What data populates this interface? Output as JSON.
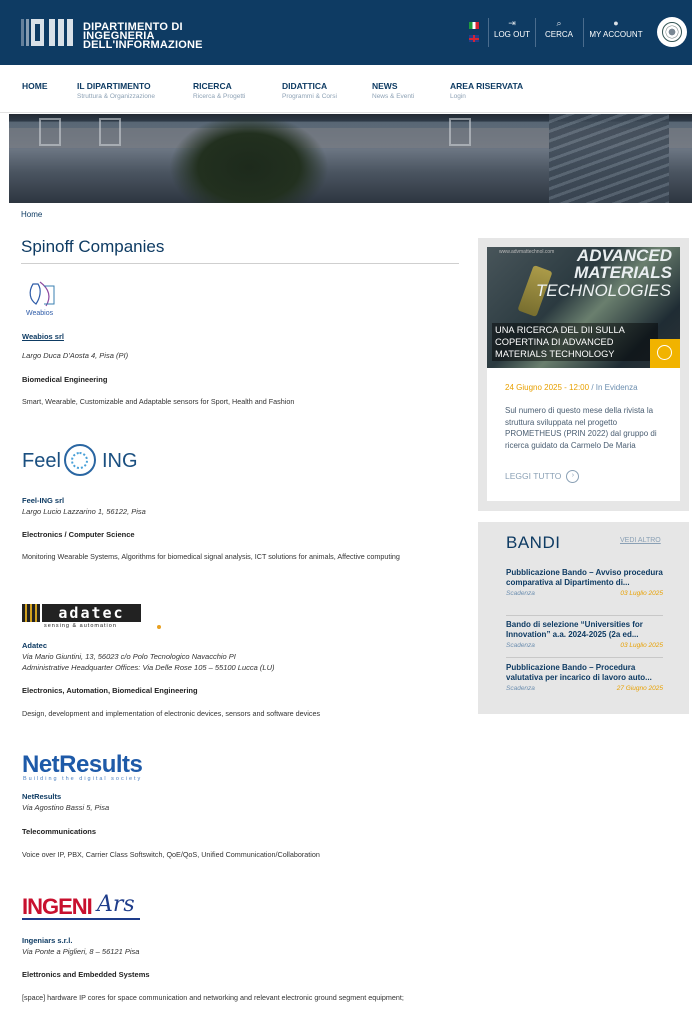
{
  "header": {
    "logo_text_line1": "DIPARTIMENTO DI",
    "logo_text_line2": "INGEGNERIA",
    "logo_text_line3": "DELL'INFORMAZIONE",
    "logout_label": "LOG OUT",
    "search_label": "CERCA",
    "account_label": "MY ACCOUNT",
    "logout_icon": "logout-icon",
    "search_icon": "search-icon",
    "account_icon": "user-icon"
  },
  "nav": [
    {
      "title": "HOME",
      "subtitle": ""
    },
    {
      "title": "IL DIPARTIMENTO",
      "subtitle": "Struttura & Organizzazione"
    },
    {
      "title": "RICERCA",
      "subtitle": "Ricerca & Progetti"
    },
    {
      "title": "DIDATTICA",
      "subtitle": "Programmi & Corsi"
    },
    {
      "title": "NEWS",
      "subtitle": "News & Eventi"
    },
    {
      "title": "AREA RISERVATA",
      "subtitle": "Login"
    }
  ],
  "breadcrumb": "Home",
  "page_title": "Spinoff Companies",
  "companies": [
    {
      "logo_text": "Weabios",
      "name": "Weabios srl",
      "address": "Largo Duca D'Aosta 4, Pisa (PI)",
      "sector": "Biomedical Engineering",
      "description": "Smart, Wearable, Customizable and Adaptable sensors for Sport, Health and Fashion"
    },
    {
      "logo_text_left": "Feel",
      "logo_text_right": "ING",
      "name": "Feel-ING srl",
      "address": "Largo Lucio Lazzarino 1, 56122, Pisa",
      "sector": "Electronics / Computer Science",
      "description": "Monitoring Wearable Systems, Algorithms for biomedical signal analysis, ICT solutions for animals, Affective computing"
    },
    {
      "logo_text": "adatec",
      "logo_tagline": "sensing & automation",
      "name": "Adatec",
      "address": "Via Mario Giuntini, 13, 56023 c/o Polo Tecnologico Navacchio PI",
      "address2": "Administrative Headquarter Offices: Via Delle Rose 105 – 55100 Lucca (LU)",
      "sector": "Electronics, Automation, Biomedical Engineering",
      "description": "Design, development and implementation of electronic devices, sensors and software devices"
    },
    {
      "logo_text": "NetResults",
      "logo_tagline": "Building the digital society",
      "name": "NetResults",
      "address": "Via Agostino Bassi 5, Pisa",
      "sector": "Telecommunications",
      "description": "Voice over IP, PBX, Carrier Class Softswitch, QoE/QoS, Unified Communication/Collaboration"
    },
    {
      "logo_text_left": "INGENI",
      "logo_text_right": "Ars",
      "name": "Ingeniars s.r.l.",
      "address": "Via Ponte a Piglieri, 8 – 56121 Pisa",
      "sector": "Elettronics and Embedded Systems",
      "description": "[space] hardware IP cores for space communication and networking and relevant electronic ground segment equipment;"
    }
  ],
  "news": {
    "image_site": "www.advmattechnol.com",
    "image_title_line1": "ADVANCED",
    "image_title_line2": "MATERIALS",
    "image_title_line3": "TECHNOLOGIES",
    "caption": "UNA RICERCA DEL DII SULLA COPERTINA DI ADVANCED MATERIALS TECHNOLOGY",
    "date": "24 Giugno 2025 - 12:00",
    "category": "/ In Evidenza",
    "text": "Sul numero di questo mese della rivista la struttura sviluppata nel progetto PROMETHEUS (PRIN 2022) dal gruppo di ricerca guidato da Carmelo De Maria",
    "more_label": "LEGGI TUTTO",
    "more_icon": "chevron-right-circle-icon"
  },
  "bandi": {
    "title": "BANDI",
    "more_label": "VEDI ALTRO",
    "items": [
      {
        "title": "Pubblicazione Bando – Avviso procedura comparativa al Dipartimento di...",
        "deadline_label": "Scadenza",
        "deadline": "03 Luglio 2025"
      },
      {
        "title": "Bando di selezione “Universities for Innovation” a.a. 2024-2025 (2a ed...",
        "deadline_label": "Scadenza",
        "deadline": "03 Luglio 2025"
      },
      {
        "title": "Pubblicazione Bando – Procedura valutativa per incarico di lavoro auto...",
        "deadline_label": "Scadenza",
        "deadline": "27 Giugno 2025"
      }
    ]
  },
  "colors": {
    "brand_navy": "#0e3b63",
    "accent_yellow": "#f1b300",
    "date_orange": "#e8a000"
  }
}
